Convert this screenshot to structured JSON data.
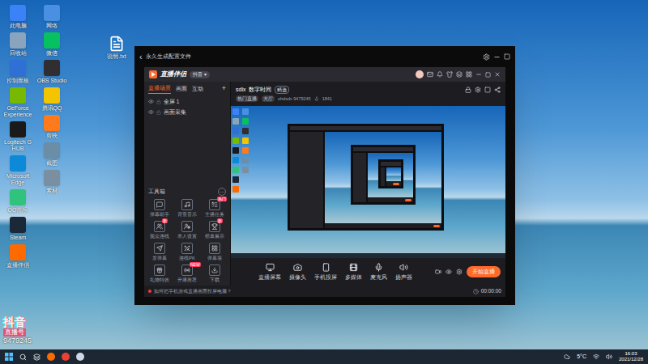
{
  "desktop": {
    "column_1": [
      {
        "label": "此电脑",
        "color": "#3b82f6"
      },
      {
        "label": "回收站",
        "color": "#8aa4bd"
      },
      {
        "label": "控制面板",
        "color": "#2f6fd6"
      },
      {
        "label": "GeForce Experience",
        "color": "#76b900"
      },
      {
        "label": "Logitech G HUB",
        "color": "#1a1a1a"
      },
      {
        "label": "Microsoft Edge",
        "color": "#0c8ad8"
      },
      {
        "label": "QQ音乐",
        "color": "#31c27c"
      },
      {
        "label": "Steam",
        "color": "#1b2838"
      },
      {
        "label": "直播伴侣",
        "color": "#ff6a00"
      }
    ],
    "column_2": [
      {
        "label": "网络",
        "color": "#4a90e2"
      },
      {
        "label": "微信",
        "color": "#07c160"
      },
      {
        "label": "OBS Studio",
        "color": "#302e31"
      },
      {
        "label": "腾讯QQ",
        "color": "#f5c400"
      },
      {
        "label": "剪映",
        "color": "#ff7a1a"
      },
      {
        "label": "截图",
        "color": "#6b8da6"
      },
      {
        "label": "素材",
        "color": "#7a8fa0"
      }
    ],
    "file_icon": {
      "label": "说明.txt"
    }
  },
  "watermark": {
    "brand": "抖音",
    "label": "直播号",
    "id": "9479245"
  },
  "outer_window": {
    "title": "永久生成配置文件",
    "back": "‹"
  },
  "app": {
    "logo": "直播伴侣",
    "account": "抖音 ▾",
    "tabs": [
      {
        "label": "直播场景",
        "selected": true
      },
      {
        "label": "画面",
        "selected": false
      },
      {
        "label": "互动",
        "selected": false
      }
    ],
    "add": "+",
    "scenes": [
      {
        "label": "全屏 1",
        "visible": true
      },
      {
        "label": "画面采集",
        "visible": true
      }
    ],
    "toolbox": {
      "title": "工具箱",
      "more": "···",
      "tools": [
        {
          "label": "弹幕助手",
          "badge": ""
        },
        {
          "label": "背景音乐",
          "badge": ""
        },
        {
          "label": "主播任务",
          "badge": "热门"
        },
        {
          "label": "观众连线",
          "badge": "新"
        },
        {
          "label": "本人设置",
          "badge": ""
        },
        {
          "label": "榜单展示",
          "badge": "新"
        },
        {
          "label": "发弹幕",
          "badge": ""
        },
        {
          "label": "连线PK",
          "badge": ""
        },
        {
          "label": "弹幕墙",
          "badge": ""
        },
        {
          "label": "礼物特效",
          "badge": ""
        },
        {
          "label": "开播推荐",
          "badge": "NEW"
        },
        {
          "label": "下载",
          "badge": ""
        }
      ]
    },
    "info": {
      "name": "sdlx",
      "title": "数字时间",
      "tag": "精选",
      "chips": [
        "热门直播",
        "大厅"
      ],
      "id": "ohdsdx 9479245",
      "fans": "1841"
    },
    "toolbar": [
      {
        "label": "直播屏幕",
        "muted": false
      },
      {
        "label": "摄像头",
        "muted": false
      },
      {
        "label": "手机投屏",
        "muted": false
      },
      {
        "label": "多媒体",
        "muted": false
      },
      {
        "label": "麦克风",
        "muted": false
      },
      {
        "label": "扬声器",
        "muted": false
      }
    ],
    "start": "开始直播",
    "status": {
      "notice": "如何把手机游戏直播画面投屏电脑？",
      "timer": "00:00:00"
    }
  },
  "taskbar": {
    "apps": [
      {
        "color": "#ff6a00"
      },
      {
        "color": "#e94235"
      },
      {
        "color": "#cfd8e3"
      }
    ],
    "weather": "5°C",
    "time": "16:03",
    "date": "2021/12/28"
  }
}
